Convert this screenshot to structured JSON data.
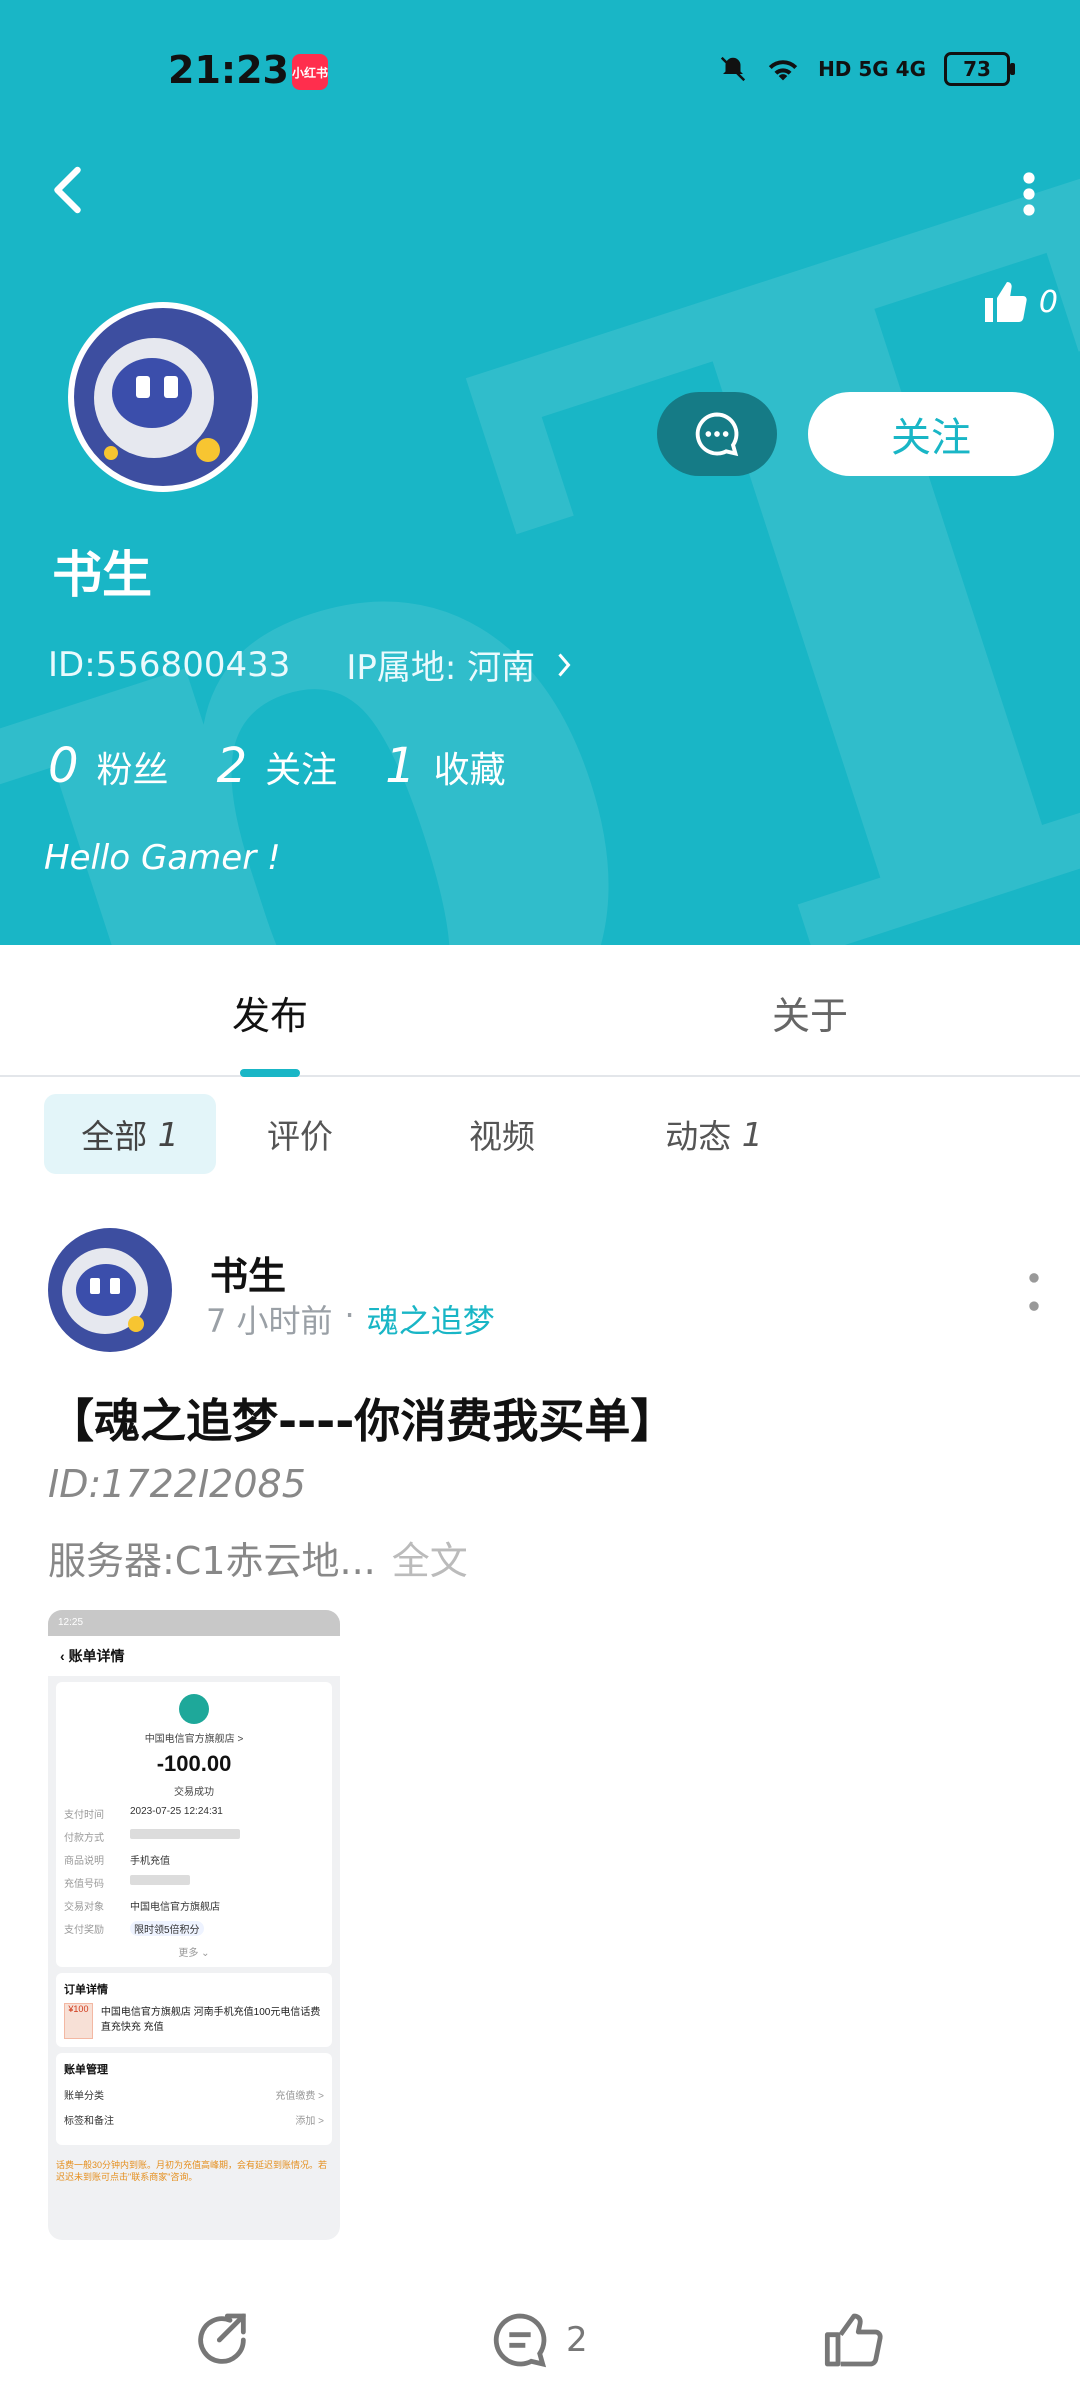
{
  "status": {
    "time": "21:23",
    "app_badge": "小红书",
    "network": "HD 5G 4G",
    "battery": "73"
  },
  "profile": {
    "name": "书生",
    "id_text": "ID:556800433",
    "ip_text": "IP属地: 河南",
    "like_count": "0",
    "follow_label": "关注",
    "stats": [
      {
        "num": "0",
        "label": "粉丝"
      },
      {
        "num": "2",
        "label": "关注"
      },
      {
        "num": "1",
        "label": "收藏"
      }
    ],
    "bio": "Hello Gamer !"
  },
  "tabs": {
    "publish": "发布",
    "about": "关于"
  },
  "filters": [
    {
      "label": "全部",
      "count": "1"
    },
    {
      "label": "评价",
      "count": ""
    },
    {
      "label": "视频",
      "count": ""
    },
    {
      "label": "动态",
      "count": "1"
    }
  ],
  "post": {
    "author": "书生",
    "time_ago": "7 小时前",
    "dot": "·",
    "game": "魂之追梦",
    "title": "【魂之追梦----你消费我买单】",
    "line1": "ID:1722I2085",
    "line2": "服务器:C1赤云地...",
    "full_text": "全文",
    "comment_count": "2",
    "thumbnail": {
      "status_time": "12:25",
      "header": "账单详情",
      "store": "中国电信官方旗舰店 >",
      "amount": "-100.00",
      "result": "交易成功",
      "rows": [
        {
          "k": "支付时间",
          "v": "2023-07-25 12:24:31"
        },
        {
          "k": "付款方式",
          "v": ""
        },
        {
          "k": "商品说明",
          "v": "手机充值"
        },
        {
          "k": "充值号码",
          "v": ""
        },
        {
          "k": "交易对象",
          "v": "中国电信官方旗舰店"
        },
        {
          "k": "支付奖励",
          "v": "限时领5倍积分"
        }
      ],
      "more": "更多 ⌄",
      "order_title": "订单详情",
      "order_img": "¥100",
      "order_text": "中国电信官方旗舰店 河南手机充值100元电信话费直充快充 充值",
      "manage_title": "账单管理",
      "manage_rows": [
        {
          "k": "账单分类",
          "v": "充值缴费 >"
        },
        {
          "k": "标签和备注",
          "v": "添加 >"
        }
      ],
      "footer": "话费一般30分钟内到账。月初为充值高峰期，会有延迟到账情况。若迟迟未到账可点击\"联系商家\"咨询。"
    }
  },
  "colors": {
    "accent": "#19b6c6",
    "header_bg": "#19b6c6",
    "message_button": "#157b86"
  }
}
